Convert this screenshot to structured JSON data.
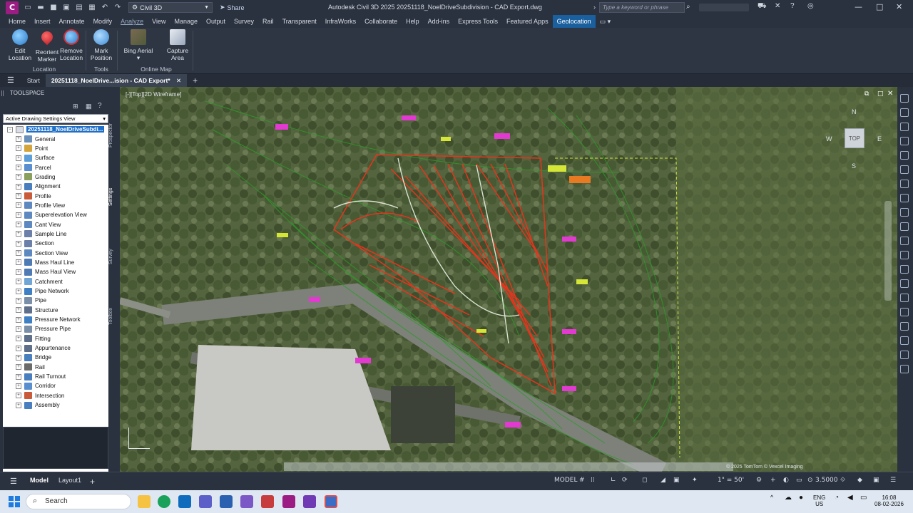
{
  "titlebar": {
    "app_letter": "C",
    "workspace": "Civil 3D",
    "share": "Share",
    "title": "Autodesk Civil 3D 2025   20251118_NoelDriveSubdivision - CAD Export.dwg",
    "search_placeholder": "Type a keyword or phrase"
  },
  "menu_tabs": [
    "Home",
    "Insert",
    "Annotate",
    "Modify",
    "Analyze",
    "View",
    "Manage",
    "Output",
    "Survey",
    "Rail",
    "Transparent",
    "InfraWorks",
    "Collaborate",
    "Help",
    "Add-ins",
    "Express Tools",
    "Featured Apps",
    "Geolocation"
  ],
  "ribbon": {
    "buttons": [
      {
        "label1": "Edit",
        "label2": "Location"
      },
      {
        "label1": "Reorient",
        "label2": "Marker"
      },
      {
        "label1": "Remove",
        "label2": "Location"
      },
      {
        "label1": "Mark",
        "label2": "Position"
      },
      {
        "label1": "Bing Aerial",
        "label2": ""
      },
      {
        "label1": "Capture",
        "label2": "Area"
      }
    ],
    "panels": [
      "Location",
      "Tools",
      "Online Map"
    ]
  },
  "doc_tabs": {
    "start": "Start",
    "active": "20251118_NoelDrive...ision - CAD Export*"
  },
  "toolspace": {
    "title": "TOOLSPACE",
    "view_select": "Active Drawing Settings View",
    "root": "20251118_NoelDriveSubdi...",
    "items": [
      "General",
      "Point",
      "Surface",
      "Parcel",
      "Grading",
      "Alignment",
      "Profile",
      "Profile View",
      "Superelevation View",
      "Cant View",
      "Sample Line",
      "Section",
      "Section View",
      "Mass Haul Line",
      "Mass Haul View",
      "Catchment",
      "Pipe Network",
      "Pipe",
      "Structure",
      "Pressure Network",
      "Pressure Pipe",
      "Fitting",
      "Appurtenance",
      "Bridge",
      "Rail",
      "Rail Turnout",
      "Corridor",
      "Intersection",
      "Assembly"
    ],
    "side_labels": [
      "Prospector",
      "Settings",
      "Survey",
      "Toolbox"
    ]
  },
  "drawing": {
    "viewport_label": "[-][Top][2D Wireframe]",
    "viewcube": "TOP",
    "compass": {
      "n": "N",
      "w": "W",
      "e": "E",
      "s": "S"
    },
    "copyright": "© 2025 TomTom © Vexcel Imaging"
  },
  "statusbar": {
    "tabs": [
      "Model",
      "Layout1"
    ],
    "mode": "MODEL",
    "scale": "1\" = 50'",
    "value": "3.5000"
  },
  "taskbar": {
    "search": "Search",
    "lang1": "ENG",
    "lang2": "US",
    "time": "16:08",
    "date": "08-02-2026"
  },
  "colors": {
    "accent": "#1a5f9e",
    "parcel_lines": "#e8331c",
    "contours": "#2d9a2a",
    "labels": "#d6e636"
  }
}
